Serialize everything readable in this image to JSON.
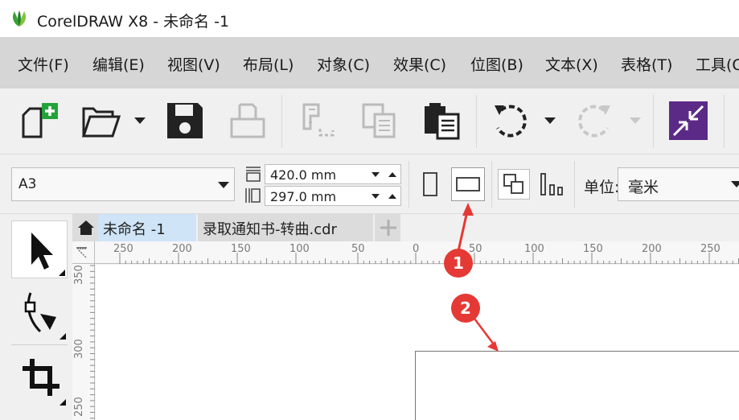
{
  "window": {
    "title": "CorelDRAW X8 - 未命名 -1",
    "accent": "#3aa235"
  },
  "menu": [
    "文件(F)",
    "编辑(E)",
    "视图(V)",
    "布局(L)",
    "对象(C)",
    "效果(C)",
    "位图(B)",
    "文本(X)",
    "表格(T)",
    "工具(O)"
  ],
  "toolbar": {
    "icons": [
      "new-document-icon",
      "open-folder-icon",
      "save-icon",
      "print-icon",
      "cut-icon",
      "copy-icon",
      "paste-icon",
      "undo-icon",
      "redo-icon",
      "import-icon"
    ]
  },
  "property_bar": {
    "page_size": "A3",
    "width": "420.0 mm",
    "height": "297.0 mm",
    "unit_label": "单位:",
    "unit_value": "毫米",
    "selected_orientation": "landscape"
  },
  "tabs": [
    "未命名 -1",
    "录取通知书-转曲.cdr"
  ],
  "ruler": {
    "h_labels": [
      "250",
      "200",
      "150",
      "100",
      "50",
      "0",
      "50",
      "100",
      "150",
      "200",
      "250"
    ],
    "v_labels": [
      "350",
      "300",
      "250"
    ]
  },
  "annotations": [
    {
      "label": "1",
      "color": "#e53935"
    },
    {
      "label": "2",
      "color": "#e53935"
    }
  ]
}
